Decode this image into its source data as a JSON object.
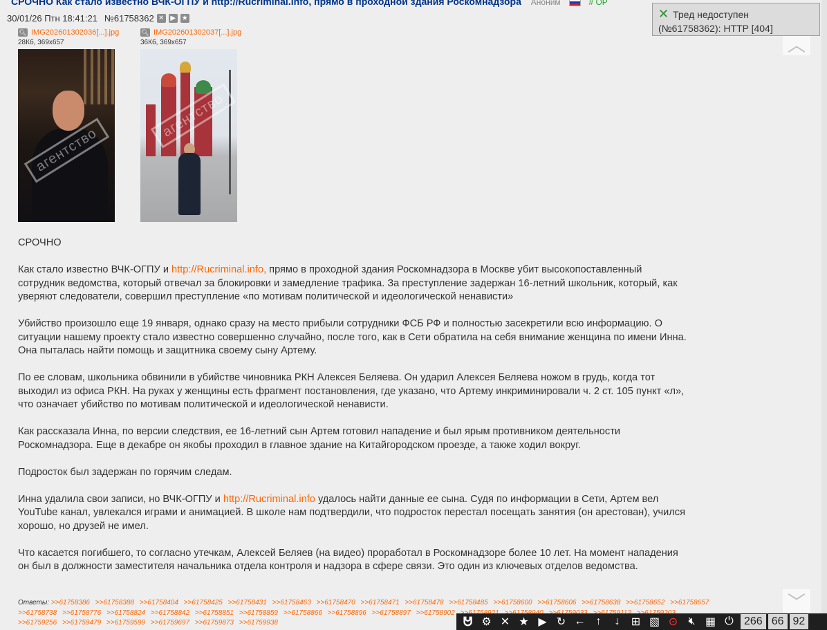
{
  "post": {
    "title": "СРОЧНО Как стало известно ВЧК-ОГПУ и http://Rucriminal.info, прямо в проходной здания Роскомнадзора",
    "author": "Аноним",
    "op_tag": "# OP",
    "datetime": "30/01/26 Птн 18:41:21",
    "number": "№61758362"
  },
  "files": [
    {
      "name": "IMG202601302036[...].jpg",
      "info": "28Кб, 369x657",
      "watermark": "агентство"
    },
    {
      "name": "IMG202601302037[...].jpg",
      "info": "36Кб, 369x657",
      "watermark": "агентство"
    }
  ],
  "body": {
    "p1": "СРОЧНО",
    "p2_a": "Как стало известно ВЧК-ОГПУ и ",
    "p2_link": "http://Rucriminal.info,",
    "p2_b": " прямо в проходной здания Роскомнадзора в Москве убит высокопоставленный сотрудник ведомства, который отвечал за блокировки и замедление трафика. За преступление задержан 16-летний школьник, который, как уверяют следователи, совершил преступление «по мотивам политической и идеологической ненависти»",
    "p3": "Убийство произошло еще 19 января, однако сразу на место прибыли сотрудники ФСБ РФ и полностью засекретили всю информацию. О ситуации нашему проекту стало известно совершенно случайно, после того, как в Сети обратила на себя внимание женщина по имени Инна. Она пыталась найти помощь и защитника своему сыну Артему.",
    "p4": "По ее словам, школьника обвинили в убийстве чиновника РКН Алексея Беляева. Он ударил Алексея Беляева ножом в грудь, когда тот выходил из офиса РКН. На руках у женщины есть фрагмент постановления, где указано, что Артему инкриминировали ч. 2 ст. 105 пункт «л», что означает убийство по мотивам политической и идеологической ненависти.",
    "p5": "Как рассказала Инна, по версии следствия, ее 16-летний сын Артем готовил нападение и был ярым противником деятельности Роскомнадзора. Еще в декабре он якобы проходил в главное здание на Китайгородском проезде, а также ходил вокруг.",
    "p6": "Подросток был задержан по горячим следам.",
    "p7_a": "Инна удалила свои записи, но ВЧК-ОГПУ и ",
    "p7_link": "http://Rucriminal.info",
    "p7_b": " удалось найти данные ее сына. Судя по информации в Сети, Артем вел YouTube канал, увлекался играми и анимацией. В школе нам подтвердили, что подросток перестал посещать занятия (он арестован), учился хорошо, но друзей не имел.",
    "p8": "Что касается погибшего, то согласно утечкам, Алексей Беляев (на видео) проработал в Роскомнадзоре более 10 лет. На момент нападения он был в должности заместителя начальника отдела контроля и надзора в сфере связи. Это один из ключевых отделов ведомства."
  },
  "replies": {
    "label": "Ответы:",
    "links": [
      ">>61758386",
      ">>61758388",
      ">>61758404",
      ">>61758425",
      ">>61758431",
      ">>61758463",
      ">>61758470",
      ">>61758471",
      ">>61758478",
      ">>61758485",
      ">>61758600",
      ">>61758606",
      ">>61758638",
      ">>61758652",
      ">>61758657",
      ">>61758738",
      ">>61758776",
      ">>61758824",
      ">>61758842",
      ">>61758851",
      ">>61758859",
      ">>61758866",
      ">>61758896",
      ">>61758897",
      ">>61758902",
      ">>61758921",
      ">>61758940",
      ">>61759033",
      ">>61759112",
      ">>61759203",
      ">>61759256",
      ">>61759479",
      ">>61759599",
      ">>61759697",
      ">>61759873",
      ">>61759938"
    ]
  },
  "notification": {
    "text": "Тред недоступен (№61758362): HTTP [404]"
  },
  "toolbar": {
    "counts": [
      "266",
      "66",
      "92"
    ]
  },
  "icons": {
    "logo": "dollchan-logo-icon",
    "settings": "gear-icon",
    "close": "close-icon",
    "favorite": "star-icon",
    "play": "play-icon",
    "refresh": "refresh-icon",
    "back": "arrow-left-icon",
    "up": "arrow-up-icon",
    "down": "arrow-down-icon"
  }
}
